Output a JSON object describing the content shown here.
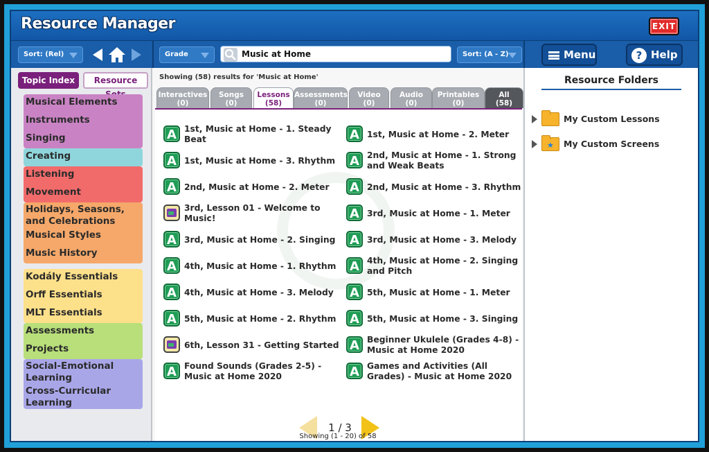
{
  "app": {
    "title": "Resource Manager",
    "exit_label": "EXIT"
  },
  "toolbar": {
    "sort_left": "Sort: (Rel)",
    "grade_label": "Grade",
    "search_value": "Music at Home",
    "sort_right": "Sort: (A - Z)",
    "menu_label": "Menu",
    "help_label": "Help"
  },
  "sidebar": {
    "tab_topic": "Topic Index",
    "tab_sets": "Resource Sets",
    "groups": [
      {
        "color": "#c983c4",
        "items": [
          "Musical Elements",
          "Instruments",
          "Singing"
        ]
      },
      {
        "color": "#8fd6dc",
        "items": [
          "Creating"
        ]
      },
      {
        "color": "#f26b6b",
        "items": [
          "Listening",
          "Movement"
        ]
      },
      {
        "color": "#f5a86a",
        "items": [
          "Holidays, Seasons, and Celebrations",
          "Musical Styles",
          "Music History"
        ]
      },
      {
        "color": "#fde08a",
        "items": [
          "Kodály Essentials",
          "Orff Essentials",
          "MLT Essentials"
        ]
      },
      {
        "color": "#b8df7a",
        "items": [
          "Assessments",
          "Projects"
        ]
      },
      {
        "color": "#a9a6e8",
        "items": [
          "Social-Emotional Learning",
          "Cross-Curricular Learning"
        ]
      }
    ]
  },
  "main": {
    "results_label": "Showing (58) results for 'Music at Home'",
    "tabs": [
      {
        "label": "Interactives",
        "count": "(0)"
      },
      {
        "label": "Songs",
        "count": "(0)"
      },
      {
        "label": "Lessons",
        "count": "(58)"
      },
      {
        "label": "Assessments",
        "count": "(0)"
      },
      {
        "label": "Video",
        "count": "(0)"
      },
      {
        "label": "Audio",
        "count": "(0)"
      },
      {
        "label": "Printables",
        "count": "(0)"
      },
      {
        "label": "All",
        "count": "(58)"
      }
    ],
    "lessons": [
      {
        "title": "1st, Music at Home - 1. Steady Beat",
        "icon": "a-badge"
      },
      {
        "title": "1st, Music at Home - 2. Meter",
        "icon": "a-badge"
      },
      {
        "title": "1st, Music at Home - 3. Rhythm",
        "icon": "a-badge"
      },
      {
        "title": "2nd, Music at Home - 1. Strong and Weak Beats",
        "icon": "a-badge"
      },
      {
        "title": "2nd, Music at Home - 2. Meter",
        "icon": "a-badge"
      },
      {
        "title": "2nd, Music at Home - 3. Rhythm",
        "icon": "a-badge"
      },
      {
        "title": "3rd, Lesson 01 - Welcome to Music!",
        "icon": "screen-badge"
      },
      {
        "title": "3rd, Music at Home - 1. Meter",
        "icon": "a-badge"
      },
      {
        "title": "3rd, Music at Home - 2. Singing",
        "icon": "a-badge"
      },
      {
        "title": "3rd, Music at Home - 3. Melody",
        "icon": "a-badge"
      },
      {
        "title": "4th, Music at Home - 1. Rhythm",
        "icon": "a-badge"
      },
      {
        "title": "4th, Music at Home - 2. Singing and Pitch",
        "icon": "a-badge"
      },
      {
        "title": "4th, Music at Home - 3. Melody",
        "icon": "a-badge"
      },
      {
        "title": "5th, Music at Home - 1. Meter",
        "icon": "a-badge"
      },
      {
        "title": "5th, Music at Home - 2. Rhythm",
        "icon": "a-badge"
      },
      {
        "title": "5th, Music at Home - 3. Singing",
        "icon": "a-badge"
      },
      {
        "title": "6th, Lesson 31 - Getting Started",
        "icon": "screen-badge"
      },
      {
        "title": "Beginner Ukulele (Grades 4-8) - Music at Home 2020",
        "icon": "a-badge"
      },
      {
        "title": "Found Sounds (Grades 2-5) - Music at Home 2020",
        "icon": "a-badge"
      },
      {
        "title": "Games and Activities (All Grades) - Music at Home 2020",
        "icon": "a-badge"
      }
    ],
    "badge_letter": "A",
    "pager": {
      "page": "1 / 3",
      "summary": "Showing (1 - 20) of 58"
    }
  },
  "right": {
    "title": "Resource Folders",
    "folders": [
      {
        "label": "My Custom Lessons",
        "icon": "folder-icon"
      },
      {
        "label": "My Custom Screens",
        "icon": "folder-star-icon"
      }
    ]
  }
}
